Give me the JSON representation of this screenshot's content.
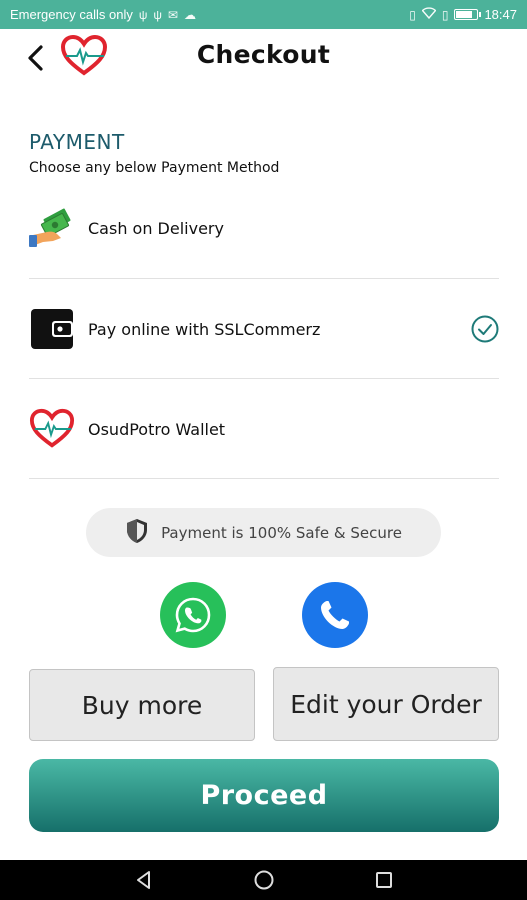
{
  "status_bar": {
    "left_text": "Emergency calls only",
    "time": "18:47",
    "icons": [
      "usb-icon",
      "usb-icon",
      "mail-icon",
      "cloud-icon",
      "vibrate-icon",
      "wifi-icon",
      "sim-icon",
      "battery-icon"
    ]
  },
  "header": {
    "title": "Checkout",
    "back_icon": "back-arrow-icon",
    "logo_icon": "heart-pulse-logo"
  },
  "payment": {
    "title": "PAYMENT",
    "subtitle": "Choose any below Payment Method",
    "methods": [
      {
        "label": "Cash on Delivery",
        "icon": "cash-hand-icon",
        "selected": false
      },
      {
        "label": "Pay online with SSLCommerz",
        "icon": "wallet-icon",
        "selected": true
      },
      {
        "label": "OsudPotro Wallet",
        "icon": "heart-pulse-logo",
        "selected": false
      }
    ]
  },
  "secure_badge": {
    "text": "Payment is 100% Safe & Secure",
    "icon": "shield-icon"
  },
  "contact": {
    "whatsapp_icon": "whatsapp-icon",
    "call_icon": "phone-icon"
  },
  "buttons": {
    "buy_more": "Buy more",
    "edit_order": "Edit your Order",
    "proceed": "Proceed"
  },
  "nav_bar": {
    "icons": [
      "nav-back-icon",
      "nav-home-icon",
      "nav-recents-icon"
    ]
  },
  "colors": {
    "status_bar": "#4cb29a",
    "heading": "#1d5b6b",
    "accent": "#1e7a78",
    "whatsapp": "#27c05a",
    "call": "#1b76ea",
    "proceed_top": "#4ab8a5",
    "proceed_bottom": "#16706a"
  }
}
